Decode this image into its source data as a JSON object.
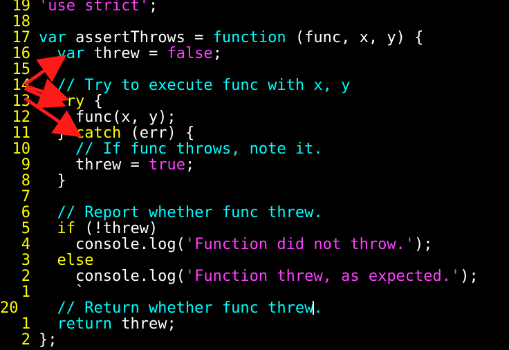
{
  "editor": {
    "line_numbers": [
      "19",
      "18",
      "17",
      "16",
      "15",
      "14",
      "13",
      "12",
      "11",
      "10",
      "9",
      "8",
      "7",
      "6",
      "5",
      "4",
      "3",
      "2",
      "1",
      "20",
      "1",
      "2"
    ],
    "lines": [
      [
        {
          "t": "'use strict'",
          "c": "str"
        },
        {
          "t": ";",
          "c": "punc"
        }
      ],
      [],
      [
        {
          "t": "var ",
          "c": "kw"
        },
        {
          "t": "assertThrows = ",
          "c": "ident"
        },
        {
          "t": "function ",
          "c": "kw"
        },
        {
          "t": "(func, x, y) {",
          "c": "ident"
        }
      ],
      [
        {
          "t": "  var ",
          "c": "kw"
        },
        {
          "t": "threw = ",
          "c": "ident"
        },
        {
          "t": "false",
          "c": "bool"
        },
        {
          "t": ";",
          "c": "punc"
        }
      ],
      [],
      [
        {
          "t": "  // Try to execute func with x, y",
          "c": "cmt"
        }
      ],
      [
        {
          "t": "  try ",
          "c": "ctl"
        },
        {
          "t": "{",
          "c": "punc"
        }
      ],
      [
        {
          "t": "    func(x, y);",
          "c": "ident"
        }
      ],
      [
        {
          "t": "  } ",
          "c": "punc"
        },
        {
          "t": "catch ",
          "c": "ctl"
        },
        {
          "t": "(err) {",
          "c": "ident"
        }
      ],
      [
        {
          "t": "    // If func throws, note it.",
          "c": "cmt"
        }
      ],
      [
        {
          "t": "    threw = ",
          "c": "ident"
        },
        {
          "t": "true",
          "c": "bool"
        },
        {
          "t": ";",
          "c": "punc"
        }
      ],
      [
        {
          "t": "  }",
          "c": "punc"
        }
      ],
      [],
      [
        {
          "t": "  // Report whether func threw.",
          "c": "cmt"
        }
      ],
      [
        {
          "t": "  if ",
          "c": "ctl"
        },
        {
          "t": "(!threw)",
          "c": "ident"
        }
      ],
      [
        {
          "t": "    console.log(",
          "c": "ident"
        },
        {
          "t": "'Function did not throw.'",
          "c": "str"
        },
        {
          "t": ");",
          "c": "punc"
        }
      ],
      [
        {
          "t": "  else",
          "c": "ctl"
        }
      ],
      [
        {
          "t": "    console.log(",
          "c": "ident"
        },
        {
          "t": "'Function threw, as expected.'",
          "c": "str"
        },
        {
          "t": ");",
          "c": "punc"
        }
      ],
      [
        {
          "t": "    `",
          "c": "ident"
        }
      ],
      [
        {
          "t": "  // Return whether func threw",
          "c": "cmt"
        },
        {
          "t": "|",
          "c": "cursor"
        },
        {
          "t": ".",
          "c": "cmt"
        }
      ],
      [
        {
          "t": "  return ",
          "c": "kw"
        },
        {
          "t": "threw;",
          "c": "ident"
        }
      ],
      [
        {
          "t": "};",
          "c": "punc"
        }
      ]
    ],
    "current_line_index": 19
  },
  "annotation": {
    "arrow_color": "#ff1a1a"
  }
}
